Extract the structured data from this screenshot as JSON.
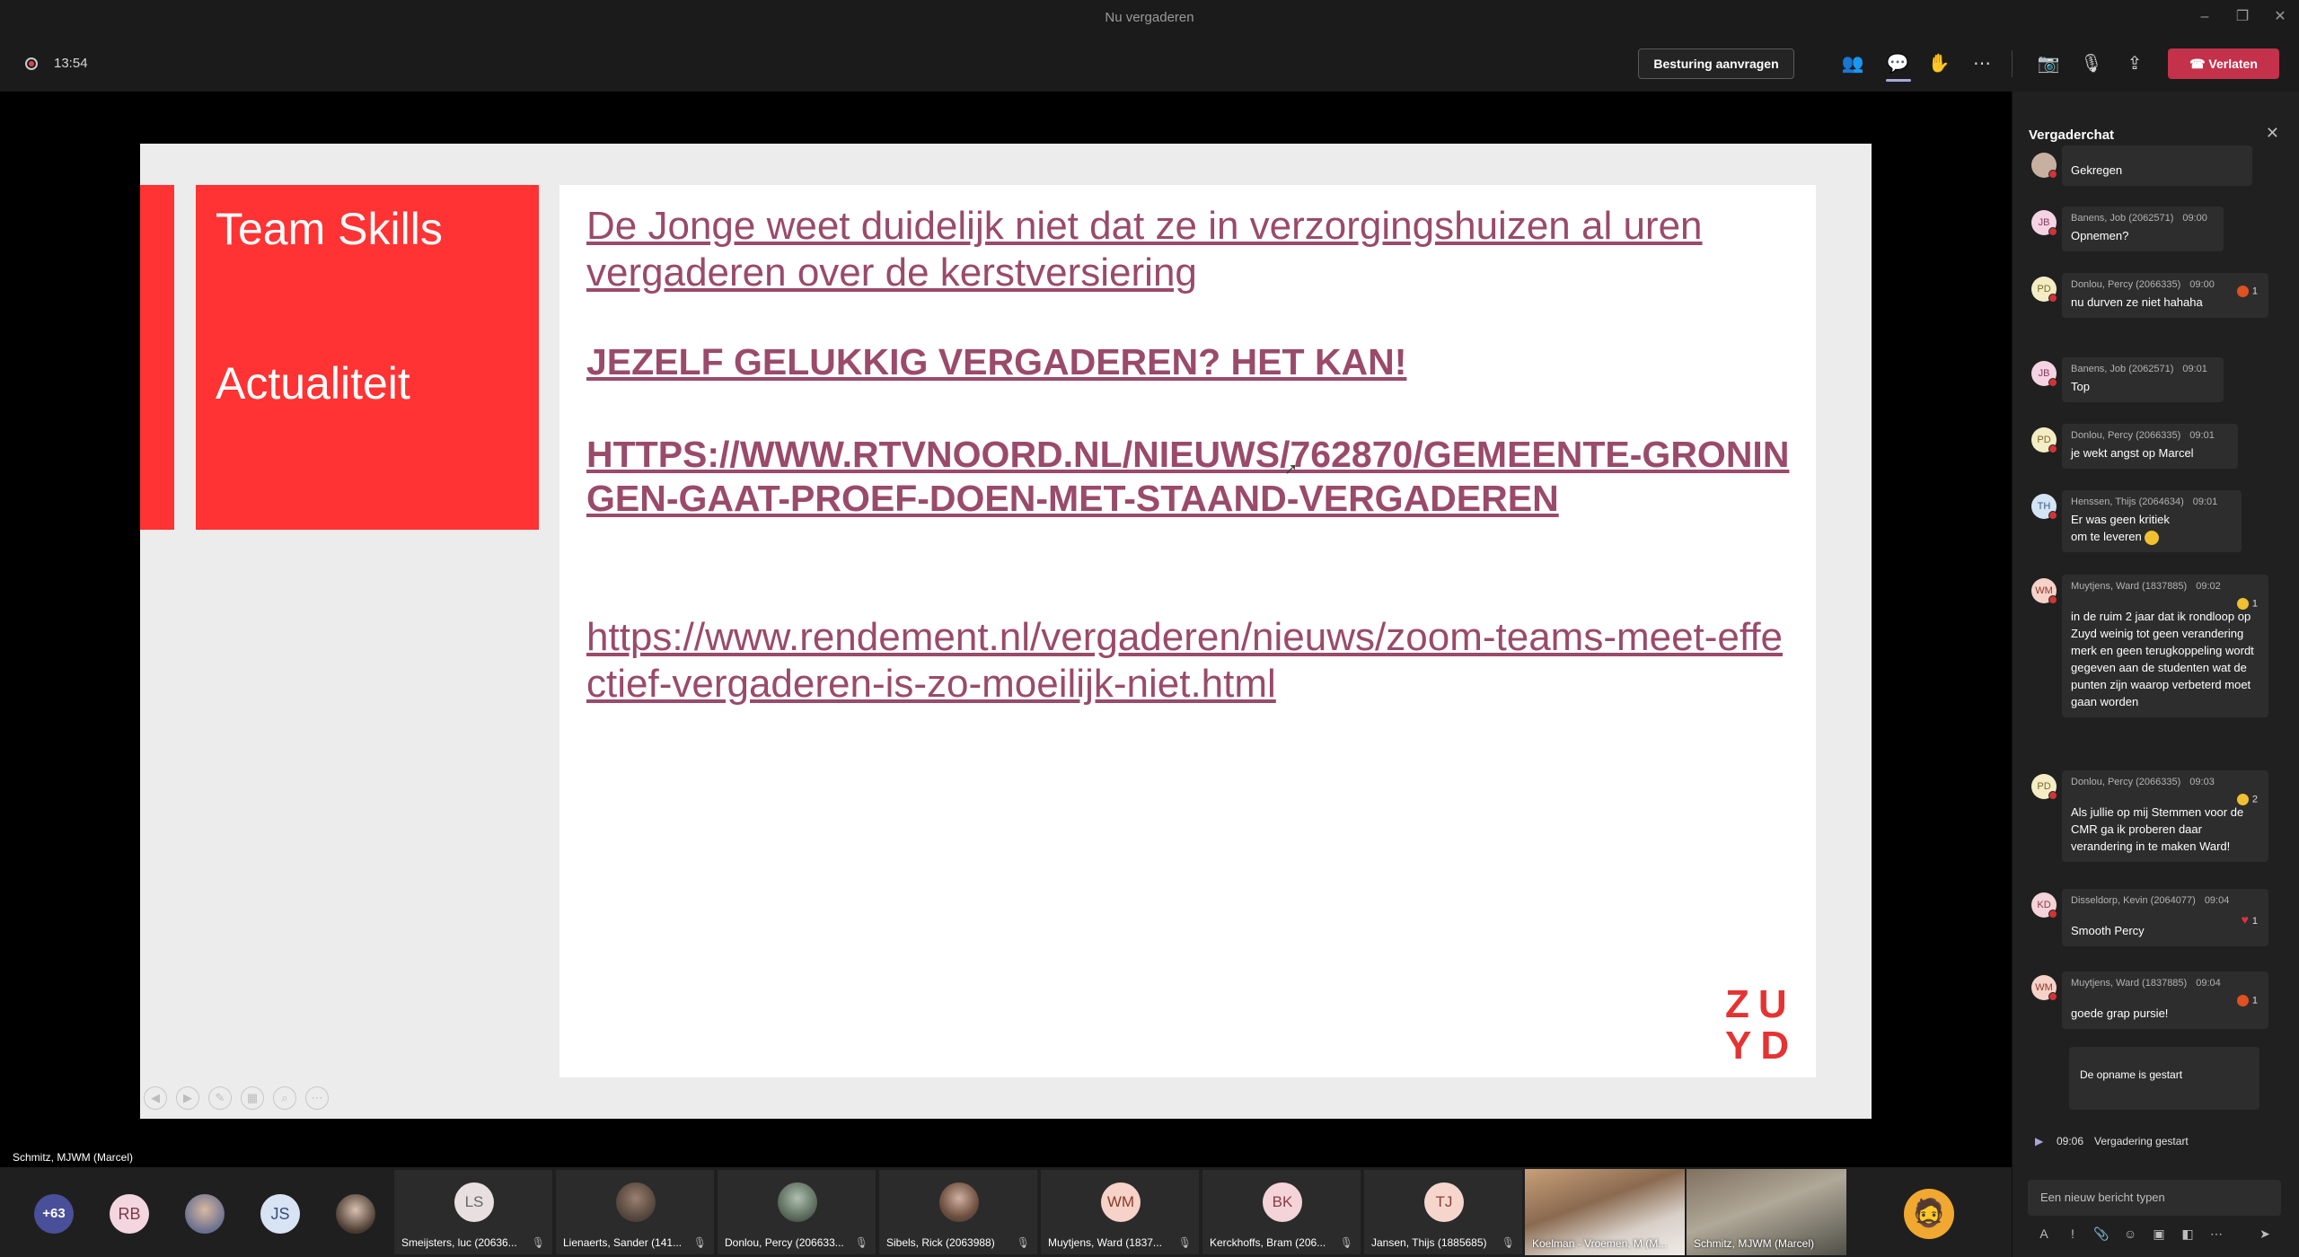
{
  "window": {
    "title": "Nu vergaderen"
  },
  "toolbar": {
    "timer": "13:54",
    "request_control": "Besturing aanvragen",
    "leave": "Verlaten"
  },
  "slide": {
    "panel_title_1": "Team Skills",
    "panel_title_2": "Actualiteit",
    "text_1": "De Jonge weet duidelijk niet dat ze in verzorgingshuizen al uren vergaderen over de kerstversiering",
    "text_2": "JEZELF GELUKKIG VERGADEREN? HET KAN!",
    "link_1": "HTTPS://WWW.RTVNOORD.NL/NIEUWS/762870/GEMEENTE-GRONINGEN-GAAT-PROEF-DOEN-MET-STAAND-VERGADEREN",
    "link_2": "https://www.rendement.nl/vergaderen/nieuws/zoom-teams-meet-effectief-vergaderen-is-zo-moeilijk-niet.html",
    "logo_line_1": "ZU",
    "logo_line_2": "YD"
  },
  "presenter": {
    "name": "Schmitz, MJWM (Marcel)"
  },
  "participants": {
    "overflow": "+63",
    "avatars": [
      "RB",
      "JS"
    ],
    "tiles": [
      {
        "initials": "LS",
        "name": "Smeijsters, luc (20636..."
      },
      {
        "initials": "",
        "name": "Lienaerts, Sander (141..."
      },
      {
        "initials": "",
        "name": "Donlou, Percy (206633..."
      },
      {
        "initials": "",
        "name": "Sibels, Rick (2063988)"
      },
      {
        "initials": "WM",
        "name": "Muytjens, Ward (1837..."
      },
      {
        "initials": "BK",
        "name": "Kerckhoffs, Bram (206..."
      },
      {
        "initials": "TJ",
        "name": "Jansen, Thijs (1885685)"
      },
      {
        "initials": "",
        "name": "Koelman - Vroemen, M (M..."
      },
      {
        "initials": "",
        "name": "Schmitz, MJWM (Marcel)"
      }
    ]
  },
  "chat": {
    "title": "Vergaderchat",
    "messages": [
      {
        "initials": "",
        "author": "",
        "time": "",
        "text": "Gekregen",
        "reaction": ""
      },
      {
        "initials": "JB",
        "author": "Banens, Job (2062571)",
        "time": "09:00",
        "text": "Opnemen?",
        "reaction": ""
      },
      {
        "initials": "PD",
        "author": "Donlou, Percy (2066335)",
        "time": "09:00",
        "text": "nu durven ze niet hahaha",
        "reaction": "1"
      },
      {
        "initials": "JB",
        "author": "Banens, Job (2062571)",
        "time": "09:01",
        "text": "Top",
        "reaction": ""
      },
      {
        "initials": "PD",
        "author": "Donlou, Percy (2066335)",
        "time": "09:01",
        "text": "je wekt angst op Marcel",
        "reaction": ""
      },
      {
        "initials": "TH",
        "author": "Henssen, Thijs (2064634)",
        "time": "09:01",
        "text": "Er was geen kritiek om te leveren",
        "reaction": ""
      },
      {
        "initials": "WM",
        "author": "Muytjens, Ward (1837885)",
        "time": "09:02",
        "text": "in de ruim 2 jaar dat ik rondloop op Zuyd weinig tot geen verandering merk en geen terugkoppeling wordt gegeven aan de studenten wat de punten zijn waarop verbeterd moet gaan worden",
        "reaction": "1"
      },
      {
        "initials": "PD",
        "author": "Donlou, Percy (2066335)",
        "time": "09:03",
        "text": "Als jullie op mij Stemmen voor de CMR ga ik proberen daar verandering in te maken Ward!",
        "reaction": "2"
      },
      {
        "initials": "KD",
        "author": "Disseldorp, Kevin (2064077)",
        "time": "09:04",
        "text": "Smooth Percy",
        "reaction": "1"
      },
      {
        "initials": "WM",
        "author": "Muytjens, Ward (1837885)",
        "time": "09:04",
        "text": "goede grap pursie!",
        "reaction": "1"
      }
    ],
    "system_bubble": "De opname is gestart",
    "system_time": "09:06",
    "system_text": "Vergadering gestart",
    "input_placeholder": "Een nieuw bericht typen"
  },
  "colors": {
    "accent_red": "#ff3333",
    "link_color": "#9a4a6a",
    "leave_button": "#c4314b",
    "teams_purple": "#4a4f9a"
  }
}
